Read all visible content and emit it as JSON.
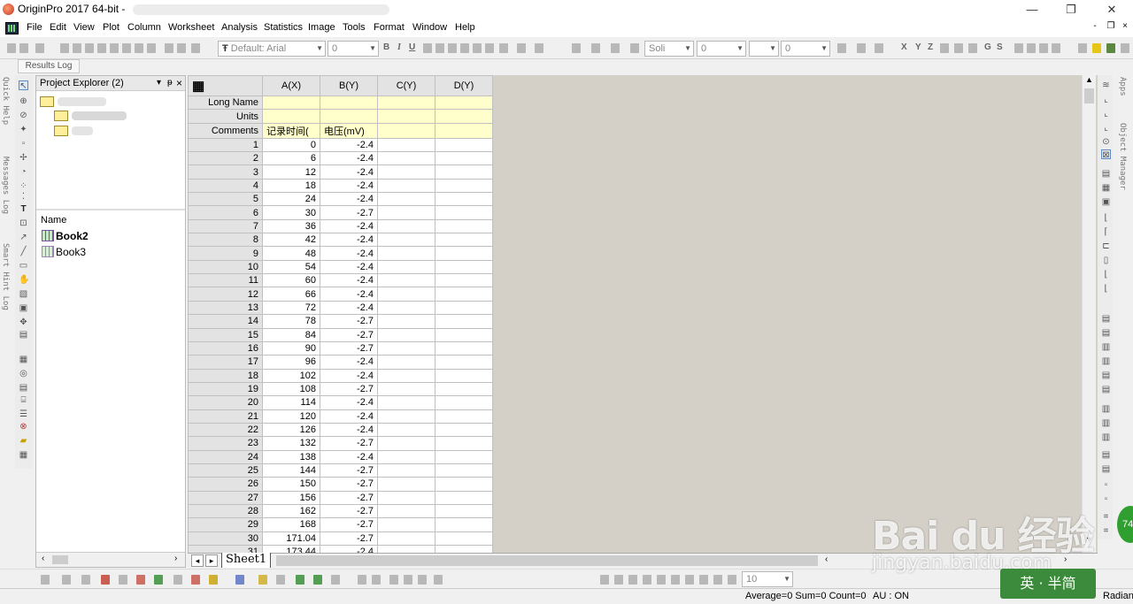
{
  "window": {
    "title": "OriginPro 2017 64-bit - ",
    "minimize_glyph": "—",
    "restore_glyph": "❐",
    "close_glyph": "✕"
  },
  "menu": {
    "items": [
      "File",
      "Edit",
      "View",
      "Plot",
      "Column",
      "Worksheet",
      "Analysis",
      "Statistics",
      "Image",
      "Tools",
      "Format",
      "Window",
      "Help"
    ],
    "mdi_minimize": "-",
    "mdi_restore": "❐",
    "mdi_close": "×"
  },
  "toolbar": {
    "font_family": "Default: Arial",
    "font_size": "0",
    "line_style": "Soli",
    "line_width": "0",
    "point_size": "0",
    "bold": "B",
    "italic": "I",
    "underline": "U",
    "plot_x": "X",
    "plot_y": "Y",
    "plot_z": "Z",
    "col_g": "G",
    "col_s": "S"
  },
  "results_log": {
    "label": "Results Log"
  },
  "left_tabs": [
    "Quick Help",
    "Messages Log",
    "Smart Hint Log"
  ],
  "right_tabs": [
    "Apps",
    "Object Manager"
  ],
  "project_explorer": {
    "title": "Project Explorer (2)",
    "pin_glyph": "▾",
    "dock_glyph": "ᵽ",
    "close_glyph": "×",
    "name_header": "Name",
    "books": [
      {
        "name": "Book2",
        "active": true
      },
      {
        "name": "Book3",
        "active": false
      }
    ]
  },
  "worksheet": {
    "columns": [
      "A(X)",
      "B(Y)",
      "C(Y)",
      "D(Y)"
    ],
    "meta_rows": [
      "Long Name",
      "Units",
      "Comments"
    ],
    "comments": [
      "记录时间(",
      "电压(mV)",
      "",
      ""
    ],
    "rows": [
      [
        "1",
        "0",
        "-2.4"
      ],
      [
        "2",
        "6",
        "-2.4"
      ],
      [
        "3",
        "12",
        "-2.4"
      ],
      [
        "4",
        "18",
        "-2.4"
      ],
      [
        "5",
        "24",
        "-2.4"
      ],
      [
        "6",
        "30",
        "-2.7"
      ],
      [
        "7",
        "36",
        "-2.4"
      ],
      [
        "8",
        "42",
        "-2.4"
      ],
      [
        "9",
        "48",
        "-2.4"
      ],
      [
        "10",
        "54",
        "-2.4"
      ],
      [
        "11",
        "60",
        "-2.4"
      ],
      [
        "12",
        "66",
        "-2.4"
      ],
      [
        "13",
        "72",
        "-2.4"
      ],
      [
        "14",
        "78",
        "-2.7"
      ],
      [
        "15",
        "84",
        "-2.7"
      ],
      [
        "16",
        "90",
        "-2.7"
      ],
      [
        "17",
        "96",
        "-2.4"
      ],
      [
        "18",
        "102",
        "-2.4"
      ],
      [
        "19",
        "108",
        "-2.7"
      ],
      [
        "20",
        "114",
        "-2.4"
      ],
      [
        "21",
        "120",
        "-2.4"
      ],
      [
        "22",
        "126",
        "-2.4"
      ],
      [
        "23",
        "132",
        "-2.7"
      ],
      [
        "24",
        "138",
        "-2.4"
      ],
      [
        "25",
        "144",
        "-2.7"
      ],
      [
        "26",
        "150",
        "-2.7"
      ],
      [
        "27",
        "156",
        "-2.7"
      ],
      [
        "28",
        "162",
        "-2.7"
      ],
      [
        "29",
        "168",
        "-2.7"
      ],
      [
        "30",
        "171.04",
        "-2.7"
      ],
      [
        "31",
        "173.44",
        "-2.4"
      ]
    ],
    "sheet_tab": "Sheet1",
    "nav_prev": "◂",
    "nav_next": "▸"
  },
  "bottom_toolbar": {
    "zoom_value": "10"
  },
  "status": {
    "summary": "Average=0 Sum=0 Count=0",
    "au": "AU : ON",
    "angle": "Radian"
  },
  "watermark": {
    "text": "Bai du 经验",
    "url": "jingyan.baidu.com",
    "badge": "英 · 半简",
    "circle": "74"
  }
}
